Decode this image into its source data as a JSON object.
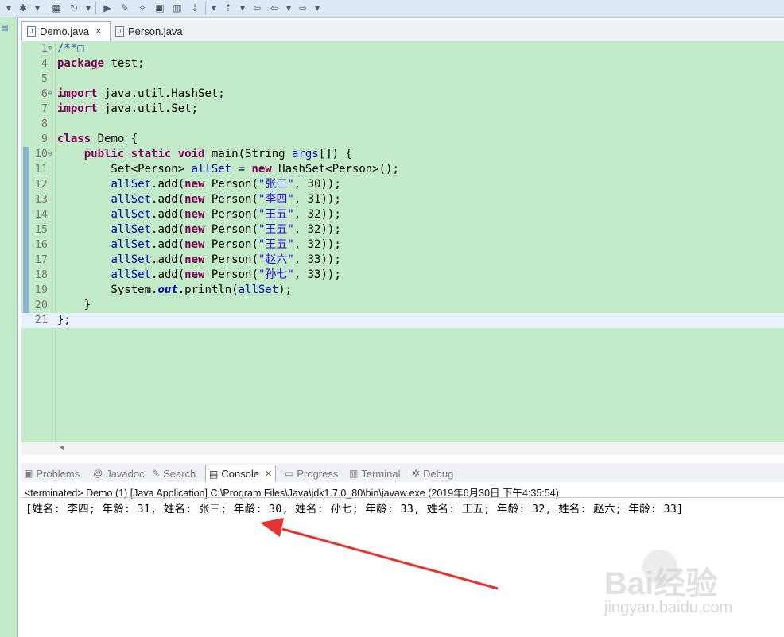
{
  "toolbar": {
    "icons": [
      "dropdown-arrow-icon",
      "debug-icon",
      "dropdown-arrow-icon",
      "package-icon",
      "refresh-icon",
      "dropdown-arrow-icon",
      "run-icon",
      "marker-icon",
      "wand-icon",
      "panel-icon",
      "pin-icon",
      "next-annotation-icon",
      "dropdown-arrow-icon",
      "prev-annotation-icon",
      "dropdown-arrow-icon",
      "back-icon",
      "back-icon",
      "dropdown-arrow-icon",
      "forward-icon",
      "dropdown-arrow-icon"
    ]
  },
  "editor_tabs": [
    {
      "label": "Demo.java",
      "active": true
    },
    {
      "label": "Person.java",
      "active": false
    }
  ],
  "code": [
    {
      "num": "1",
      "fold": "⊕",
      "parts": [
        {
          "t": "/**",
          "c": "com"
        },
        {
          "t": "□",
          "c": "com"
        }
      ]
    },
    {
      "num": "4",
      "fold": "",
      "parts": [
        {
          "t": "package",
          "c": "kw"
        },
        {
          "t": " test;",
          "c": ""
        }
      ]
    },
    {
      "num": "5",
      "fold": "",
      "parts": []
    },
    {
      "num": "6",
      "fold": "⊖",
      "parts": [
        {
          "t": "import",
          "c": "kw"
        },
        {
          "t": " java.util.HashSet;",
          "c": ""
        }
      ]
    },
    {
      "num": "7",
      "fold": "",
      "parts": [
        {
          "t": "import",
          "c": "kw"
        },
        {
          "t": " java.util.Set;",
          "c": ""
        }
      ]
    },
    {
      "num": "8",
      "fold": "",
      "parts": []
    },
    {
      "num": "9",
      "fold": "",
      "parts": [
        {
          "t": "class",
          "c": "kw"
        },
        {
          "t": " Demo {",
          "c": ""
        }
      ]
    },
    {
      "num": "10",
      "fold": "⊖",
      "parts": [
        {
          "t": "    ",
          "c": ""
        },
        {
          "t": "public",
          "c": "kw"
        },
        {
          "t": " ",
          "c": ""
        },
        {
          "t": "static",
          "c": "kw"
        },
        {
          "t": " ",
          "c": ""
        },
        {
          "t": "void",
          "c": "kw"
        },
        {
          "t": " main(String ",
          "c": ""
        },
        {
          "t": "args",
          "c": "fld"
        },
        {
          "t": "[]) {",
          "c": ""
        }
      ]
    },
    {
      "num": "11",
      "fold": "",
      "parts": [
        {
          "t": "        Set<Person> ",
          "c": ""
        },
        {
          "t": "allSet",
          "c": "fld"
        },
        {
          "t": " = ",
          "c": ""
        },
        {
          "t": "new",
          "c": "kw"
        },
        {
          "t": " HashSet<Person>();",
          "c": ""
        }
      ]
    },
    {
      "num": "12",
      "fold": "",
      "parts": [
        {
          "t": "        ",
          "c": ""
        },
        {
          "t": "allSet",
          "c": "fld"
        },
        {
          "t": ".add(",
          "c": ""
        },
        {
          "t": "new",
          "c": "kw"
        },
        {
          "t": " Person(",
          "c": ""
        },
        {
          "t": "\"张三\"",
          "c": "str"
        },
        {
          "t": ", 30));",
          "c": ""
        }
      ]
    },
    {
      "num": "13",
      "fold": "",
      "parts": [
        {
          "t": "        ",
          "c": ""
        },
        {
          "t": "allSet",
          "c": "fld"
        },
        {
          "t": ".add(",
          "c": ""
        },
        {
          "t": "new",
          "c": "kw"
        },
        {
          "t": " Person(",
          "c": ""
        },
        {
          "t": "\"李四\"",
          "c": "str"
        },
        {
          "t": ", 31));",
          "c": ""
        }
      ]
    },
    {
      "num": "14",
      "fold": "",
      "parts": [
        {
          "t": "        ",
          "c": ""
        },
        {
          "t": "allSet",
          "c": "fld"
        },
        {
          "t": ".add(",
          "c": ""
        },
        {
          "t": "new",
          "c": "kw"
        },
        {
          "t": " Person(",
          "c": ""
        },
        {
          "t": "\"王五\"",
          "c": "str"
        },
        {
          "t": ", 32));",
          "c": ""
        }
      ]
    },
    {
      "num": "15",
      "fold": "",
      "parts": [
        {
          "t": "        ",
          "c": ""
        },
        {
          "t": "allSet",
          "c": "fld"
        },
        {
          "t": ".add(",
          "c": ""
        },
        {
          "t": "new",
          "c": "kw"
        },
        {
          "t": " Person(",
          "c": ""
        },
        {
          "t": "\"王五\"",
          "c": "str"
        },
        {
          "t": ", 32));",
          "c": ""
        }
      ]
    },
    {
      "num": "16",
      "fold": "",
      "parts": [
        {
          "t": "        ",
          "c": ""
        },
        {
          "t": "allSet",
          "c": "fld"
        },
        {
          "t": ".add(",
          "c": ""
        },
        {
          "t": "new",
          "c": "kw"
        },
        {
          "t": " Person(",
          "c": ""
        },
        {
          "t": "\"王五\"",
          "c": "str"
        },
        {
          "t": ", 32));",
          "c": ""
        }
      ]
    },
    {
      "num": "17",
      "fold": "",
      "parts": [
        {
          "t": "        ",
          "c": ""
        },
        {
          "t": "allSet",
          "c": "fld"
        },
        {
          "t": ".add(",
          "c": ""
        },
        {
          "t": "new",
          "c": "kw"
        },
        {
          "t": " Person(",
          "c": ""
        },
        {
          "t": "\"赵六\"",
          "c": "str"
        },
        {
          "t": ", 33));",
          "c": ""
        }
      ]
    },
    {
      "num": "18",
      "fold": "",
      "parts": [
        {
          "t": "        ",
          "c": ""
        },
        {
          "t": "allSet",
          "c": "fld"
        },
        {
          "t": ".add(",
          "c": ""
        },
        {
          "t": "new",
          "c": "kw"
        },
        {
          "t": " Person(",
          "c": ""
        },
        {
          "t": "\"孙七\"",
          "c": "str"
        },
        {
          "t": ", 33));",
          "c": ""
        }
      ]
    },
    {
      "num": "19",
      "fold": "",
      "parts": [
        {
          "t": "        System.",
          "c": ""
        },
        {
          "t": "out",
          "c": "sfld"
        },
        {
          "t": ".println(",
          "c": ""
        },
        {
          "t": "allSet",
          "c": "fld"
        },
        {
          "t": ");",
          "c": ""
        }
      ]
    },
    {
      "num": "20",
      "fold": "",
      "parts": [
        {
          "t": "    }",
          "c": ""
        }
      ]
    },
    {
      "num": "21",
      "fold": "",
      "parts": [
        {
          "t": "};",
          "c": ""
        }
      ],
      "current": true
    }
  ],
  "views": [
    {
      "label": "Problems",
      "icon": "problems-icon",
      "glyph": "▣",
      "active": false
    },
    {
      "label": "Javadoc",
      "icon": "at-icon",
      "glyph": "@",
      "active": false
    },
    {
      "label": "Search",
      "icon": "search-icon",
      "glyph": "✎",
      "active": false
    },
    {
      "label": "Console",
      "icon": "console-icon",
      "glyph": "▤",
      "active": true
    },
    {
      "label": "Progress",
      "icon": "progress-icon",
      "glyph": "▭",
      "active": false
    },
    {
      "label": "Terminal",
      "icon": "terminal-icon",
      "glyph": "▥",
      "active": false
    },
    {
      "label": "Debug",
      "icon": "bug-icon",
      "glyph": "✲",
      "active": false
    }
  ],
  "console": {
    "terminated": "<terminated> Demo (1) [Java Application] C:\\Program Files\\Java\\jdk1.7.0_80\\bin\\javaw.exe (2019年6月30日 下午4:35:54)",
    "output": "[姓名: 李四; 年龄: 31, 姓名: 张三; 年龄: 30, 姓名: 孙七; 年龄: 33, 姓名: 王五; 年龄: 32, 姓名: 赵六; 年龄: 33]"
  },
  "watermark": {
    "brand": "Bai经验",
    "site": "jingyan.baidu.com"
  },
  "colors": {
    "editor_bg": "#c3ebc9",
    "keyword": "#7f0055",
    "string": "#2a00ff",
    "field": "#0000c0",
    "arrow": "#e8322f"
  }
}
